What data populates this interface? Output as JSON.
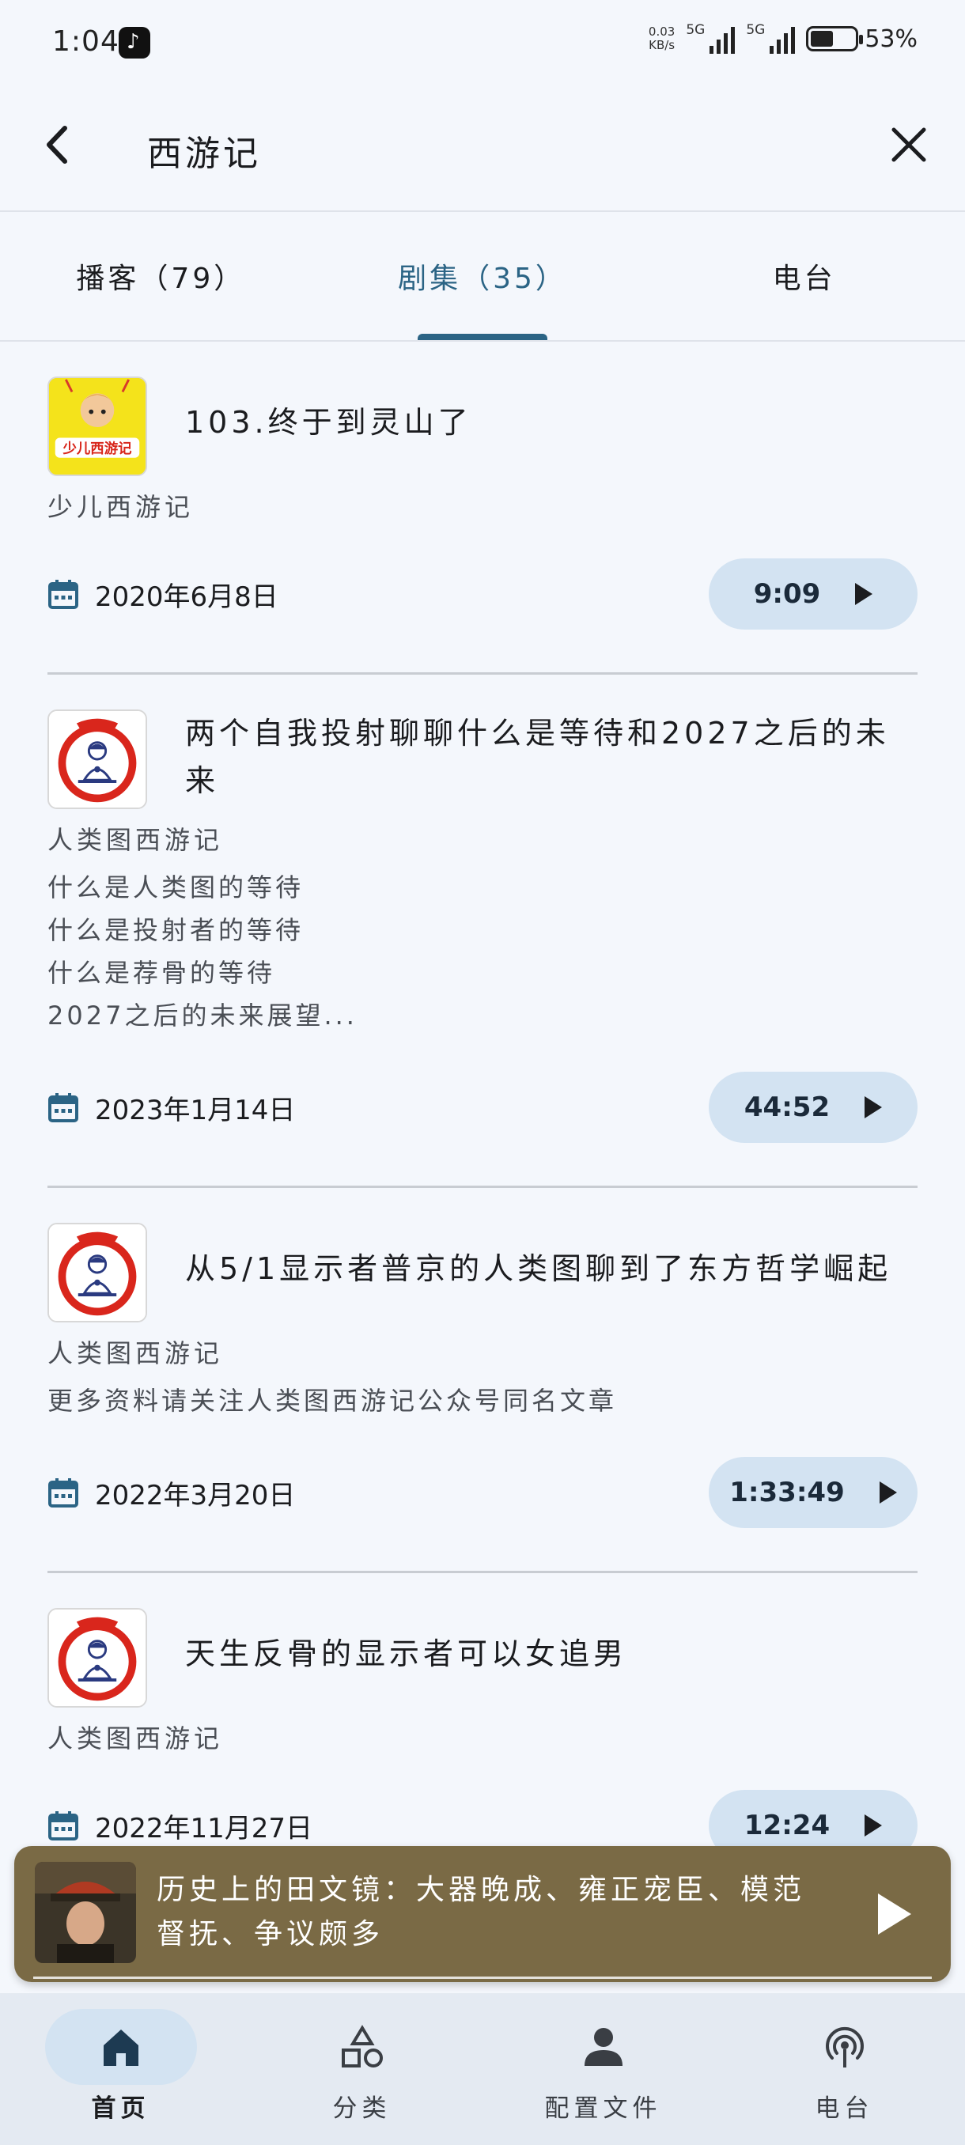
{
  "status_bar": {
    "time": "1:04",
    "net_speed_value": "0.03",
    "net_speed_unit": "KB/s",
    "signal_1": "5G",
    "signal_2": "5G",
    "battery": "53%"
  },
  "header": {
    "title": "西游记"
  },
  "tabs": [
    {
      "label": "播客（79）",
      "active": false
    },
    {
      "label": "剧集（35）",
      "active": true
    },
    {
      "label": "电台",
      "active": false
    }
  ],
  "episodes": [
    {
      "title": "103.终于到灵山了",
      "podcast": "少儿西游记",
      "description": "",
      "date": "2020年6月8日",
      "duration": "9:09",
      "thumb_icon": "monkey-king-cover"
    },
    {
      "title": "两个自我投射聊聊什么是等待和2027之后的未来",
      "podcast": "人类图西游记",
      "description": "什么是人类图的等待\n什么是投射者的等待\n什么是荐骨的等待\n2027之后的未来展望...",
      "date": "2023年1月14日",
      "duration": "44:52",
      "thumb_icon": "meditating-monk-cover"
    },
    {
      "title": "从5/1显示者普京的人类图聊到了东方哲学崛起",
      "podcast": "人类图西游记",
      "description": "更多资料请关注人类图西游记公众号同名文章",
      "date": "2022年3月20日",
      "duration": "1:33:49",
      "thumb_icon": "meditating-monk-cover"
    },
    {
      "title": "天生反骨的显示者可以女追男",
      "podcast": "人类图西游记",
      "description": "",
      "date": "2022年11月27日",
      "duration": "12:24",
      "thumb_icon": "meditating-monk-cover"
    }
  ],
  "mini_player": {
    "title": "历史上的田文镜：大器晚成、雍正宠臣、模范督抚、争议颇多",
    "art_icon": "qing-official-portrait",
    "play_icon": "play-icon"
  },
  "bottom_nav": [
    {
      "label": "首页",
      "icon": "home-icon",
      "active": true
    },
    {
      "label": "分类",
      "icon": "shapes-icon",
      "active": false
    },
    {
      "label": "配置文件",
      "icon": "person-icon",
      "active": false
    },
    {
      "label": "电台",
      "icon": "radio-icon",
      "active": false
    }
  ],
  "colors": {
    "accent": "#2b6485",
    "pill": "#d3e3f2",
    "mini_player_bg": "#7a6a45",
    "background": "#f4f7fc"
  }
}
